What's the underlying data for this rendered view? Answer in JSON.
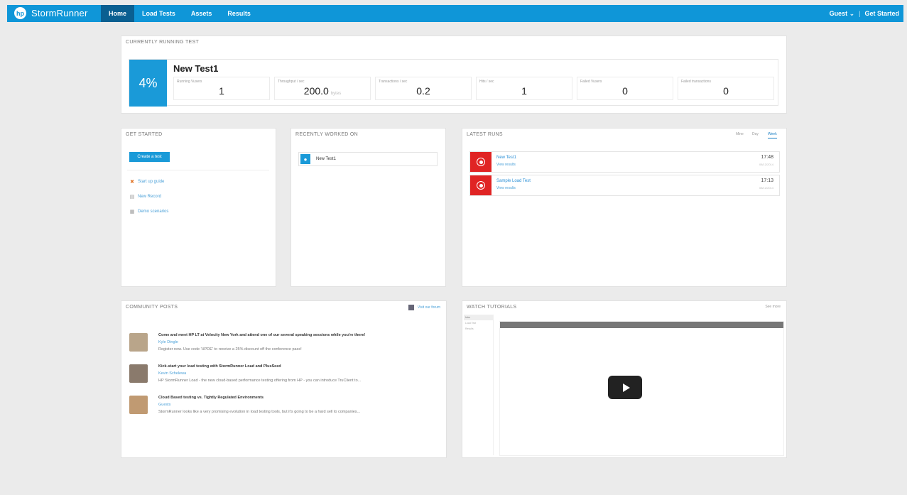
{
  "app": {
    "name": "StormRunner",
    "logo_text": "hp"
  },
  "nav": {
    "tabs": [
      {
        "label": "Home",
        "active": true
      },
      {
        "label": "Load Tests",
        "active": false
      },
      {
        "label": "Assets",
        "active": false
      },
      {
        "label": "Results",
        "active": false
      }
    ],
    "user_label": "Guest",
    "get_started_label": "Get Started"
  },
  "running": {
    "title": "Currently running test",
    "percent": "4%",
    "test_name": "New Test1",
    "metrics": [
      {
        "label": "Running Vusers",
        "value": "1",
        "unit": ""
      },
      {
        "label": "Throughput / sec",
        "value": "200.0",
        "unit": "bytes"
      },
      {
        "label": "Transactions / sec",
        "value": "0.2",
        "unit": ""
      },
      {
        "label": "Hits / sec",
        "value": "1",
        "unit": ""
      },
      {
        "label": "Failed Vusers",
        "value": "0",
        "unit": ""
      },
      {
        "label": "Failed transactions",
        "value": "0",
        "unit": ""
      }
    ]
  },
  "get_started": {
    "title": "Get started",
    "create_button": "Create a test",
    "links": [
      {
        "label": "Start up guide",
        "icon": "x-icon"
      },
      {
        "label": "New Record",
        "icon": "doc-icon"
      },
      {
        "label": "Demo scenarios",
        "icon": "grid-icon"
      }
    ]
  },
  "recent": {
    "title": "Recently worked on",
    "items": [
      {
        "label": "New Test1"
      }
    ]
  },
  "latest_runs": {
    "title": "Latest runs",
    "filters": [
      {
        "label": "Mine",
        "active": false
      },
      {
        "label": "Day",
        "active": false
      },
      {
        "label": "Week",
        "active": true
      }
    ],
    "runs": [
      {
        "name": "New Test1",
        "sub": "View results",
        "time": "17:48",
        "date": "08/12/2014"
      },
      {
        "name": "Sample Load Test",
        "sub": "View results",
        "time": "17:13",
        "date": "08/12/2014"
      }
    ],
    "status_color": "#e02424"
  },
  "community": {
    "title": "Community posts",
    "follow_label": "Visit our forum",
    "posts": [
      {
        "title": "Come and meet HP LT at Velocity New York and attend one of our several speaking sessions while you're there!",
        "author": "Kyle Dingle",
        "body": "Register now. Use code 'HPDE' to receive a 25% discount off the conference pass!",
        "avatar_color": "#b9a58a"
      },
      {
        "title": "Kick-start your load testing with StormRunner Load and PlusSeed",
        "author": "Kevin Schelewa",
        "body": "HP StormRunner Load - the new cloud-based performance testing offering from HP - you can introduce TruClient to...",
        "avatar_color": "#8a7a6c"
      },
      {
        "title": "Cloud Based testing vs. Tightly Regulated Environments",
        "author": "Guests",
        "body": "StormRunner looks like a very promising evolution in load testing tools, but it's going to be a hard sell to companies...",
        "avatar_color": "#c09a72"
      }
    ]
  },
  "tutorials": {
    "title": "Watch tutorials",
    "see_more": "See more",
    "side_items": [
      "Intro",
      "Load Test",
      "Results"
    ]
  },
  "colors": {
    "brand": "#0f96d8",
    "nav_active": "#0a5f91",
    "accent": "#1a9ad8",
    "error": "#e02424"
  }
}
